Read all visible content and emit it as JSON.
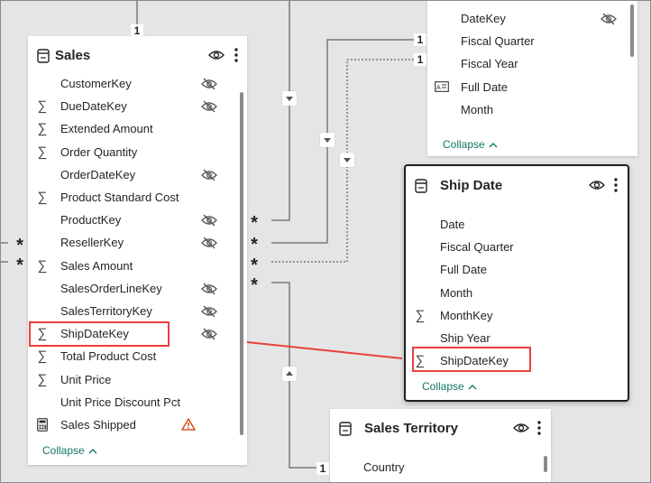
{
  "colors": {
    "accent": "#117865",
    "highlight": "#e8403e",
    "warning": "#d83b01"
  },
  "relationships": {
    "one_labels": [
      "1",
      "1",
      "1",
      "1"
    ],
    "many_labels": [
      "*",
      "*",
      "*",
      "*",
      "*",
      "*"
    ]
  },
  "sales": {
    "title": "Sales",
    "fields": [
      {
        "label": "CustomerKey",
        "icon": "none",
        "hidden": true
      },
      {
        "label": "DueDateKey",
        "icon": "sigma",
        "hidden": true
      },
      {
        "label": "Extended Amount",
        "icon": "sigma",
        "hidden": false
      },
      {
        "label": "Order Quantity",
        "icon": "sigma",
        "hidden": false
      },
      {
        "label": "OrderDateKey",
        "icon": "none",
        "hidden": true
      },
      {
        "label": "Product Standard Cost",
        "icon": "sigma",
        "hidden": false
      },
      {
        "label": "ProductKey",
        "icon": "none",
        "hidden": true
      },
      {
        "label": "ResellerKey",
        "icon": "none",
        "hidden": true
      },
      {
        "label": "Sales Amount",
        "icon": "sigma",
        "hidden": false
      },
      {
        "label": "SalesOrderLineKey",
        "icon": "none",
        "hidden": true
      },
      {
        "label": "SalesTerritoryKey",
        "icon": "none",
        "hidden": true
      },
      {
        "label": "ShipDateKey",
        "icon": "sigma",
        "hidden": true
      },
      {
        "label": "Total Product Cost",
        "icon": "sigma",
        "hidden": false
      },
      {
        "label": "Unit Price",
        "icon": "sigma",
        "hidden": false
      },
      {
        "label": "Unit Price Discount Pct",
        "icon": "none",
        "hidden": false
      },
      {
        "label": "Sales Shipped",
        "icon": "calculator",
        "hidden": false,
        "warning": true
      }
    ],
    "collapse_label": "Collapse"
  },
  "date_table": {
    "fields": [
      {
        "label": "DateKey",
        "icon": "none",
        "hidden": true
      },
      {
        "label": "Fiscal Quarter",
        "icon": "none",
        "hidden": false
      },
      {
        "label": "Fiscal Year",
        "icon": "none",
        "hidden": false
      },
      {
        "label": "Full Date",
        "icon": "text",
        "hidden": false
      },
      {
        "label": "Month",
        "icon": "none",
        "hidden": false
      }
    ],
    "collapse_label": "Collapse"
  },
  "ship_date": {
    "title": "Ship Date",
    "fields": [
      {
        "label": "Date",
        "icon": "none"
      },
      {
        "label": "Fiscal Quarter",
        "icon": "none"
      },
      {
        "label": "Full Date",
        "icon": "none"
      },
      {
        "label": "Month",
        "icon": "none"
      },
      {
        "label": "MonthKey",
        "icon": "sigma"
      },
      {
        "label": "Ship Year",
        "icon": "none"
      },
      {
        "label": "ShipDateKey",
        "icon": "sigma"
      }
    ],
    "collapse_label": "Collapse"
  },
  "sales_territory": {
    "title": "Sales Territory",
    "fields": [
      {
        "label": "Country",
        "icon": "none"
      }
    ]
  }
}
